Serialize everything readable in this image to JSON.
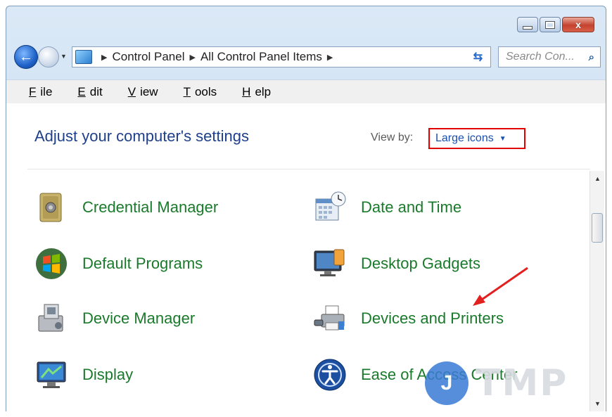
{
  "window": {
    "controls": {
      "minimize": "minimize-icon",
      "maximize": "maximize-icon",
      "close": "close-icon",
      "close_glyph": "x"
    }
  },
  "nav": {
    "back_glyph": "←",
    "breadcrumb": [
      "Control Panel",
      "All Control Panel Items"
    ],
    "refresh_glyph": "⇆",
    "search_placeholder": "Search Con...",
    "search_glyph": "⌕"
  },
  "menu": {
    "items": [
      {
        "label": "File",
        "hotkey": "F"
      },
      {
        "label": "Edit",
        "hotkey": "E"
      },
      {
        "label": "View",
        "hotkey": "V"
      },
      {
        "label": "Tools",
        "hotkey": "T"
      },
      {
        "label": "Help",
        "hotkey": "H"
      }
    ]
  },
  "content": {
    "heading": "Adjust your computer's settings",
    "view_by_label": "View by:",
    "view_by_value": "Large icons",
    "accent_color": "#e00000",
    "items": [
      {
        "label": "Credential Manager",
        "icon": "vault-icon"
      },
      {
        "label": "Date and Time",
        "icon": "calendar-clock-icon"
      },
      {
        "label": "Default Programs",
        "icon": "windows-logo-icon"
      },
      {
        "label": "Desktop Gadgets",
        "icon": "gadgets-monitor-icon"
      },
      {
        "label": "Device Manager",
        "icon": "device-manager-icon"
      },
      {
        "label": "Devices and Printers",
        "icon": "printer-icon"
      },
      {
        "label": "Display",
        "icon": "display-monitor-icon"
      },
      {
        "label": "Ease of Access Center",
        "icon": "ease-of-access-icon"
      }
    ]
  },
  "watermark": {
    "letter": "J",
    "text": "TMP"
  }
}
